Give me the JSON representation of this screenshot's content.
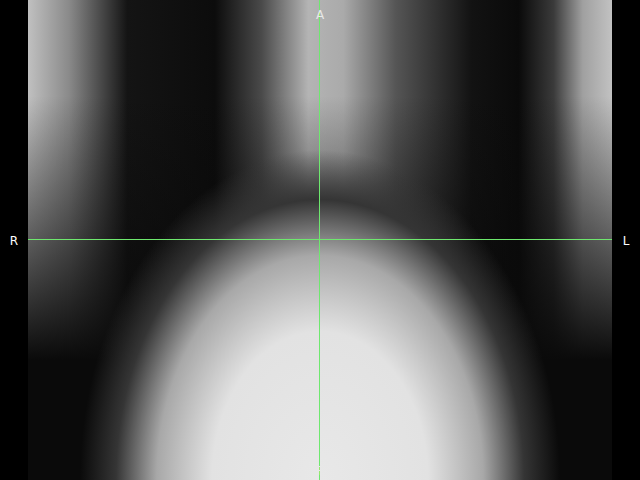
{
  "viewer": {
    "orientation": {
      "left": "R",
      "right": "L",
      "top": "A",
      "bottom": "P"
    }
  }
}
